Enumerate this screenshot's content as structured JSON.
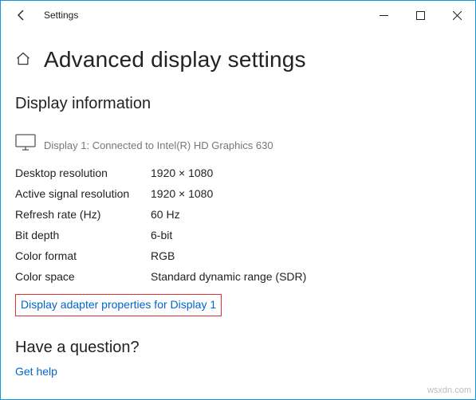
{
  "titlebar": {
    "app_title": "Settings"
  },
  "page": {
    "title": "Advanced display settings"
  },
  "display_info": {
    "section_title": "Display information",
    "connected_text": "Display 1: Connected to Intel(R) HD Graphics 630",
    "rows": [
      {
        "label": "Desktop resolution",
        "value": "1920 × 1080"
      },
      {
        "label": "Active signal resolution",
        "value": "1920 × 1080"
      },
      {
        "label": "Refresh rate (Hz)",
        "value": "60 Hz"
      },
      {
        "label": "Bit depth",
        "value": "6-bit"
      },
      {
        "label": "Color format",
        "value": "RGB"
      },
      {
        "label": "Color space",
        "value": "Standard dynamic range (SDR)"
      }
    ],
    "adapter_link": "Display adapter properties for Display 1"
  },
  "question": {
    "title": "Have a question?",
    "help_link": "Get help"
  },
  "watermark": "wsxdn.com"
}
